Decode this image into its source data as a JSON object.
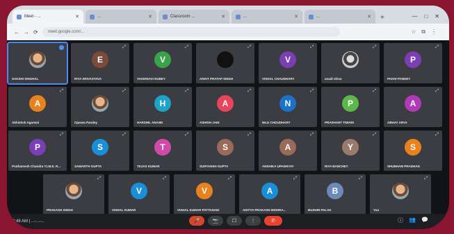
{
  "browser": {
    "tabs": [
      {
        "label": "Meet - ..."
      },
      {
        "label": "..."
      },
      {
        "label": "Classroom ..."
      },
      {
        "label": "..."
      },
      {
        "label": "..."
      }
    ],
    "new_tab": "+",
    "window_controls": [
      "—",
      "□",
      "✕"
    ],
    "url": "meet.google.com/..."
  },
  "participants_rows": [
    [
      {
        "name": "SAKSHI SINGHAL",
        "initial": "",
        "color": "",
        "kind": "photo",
        "active": true,
        "badge": "..."
      },
      {
        "name": "RIYA SRIVASTAVA",
        "initial": "E",
        "color": "#7a4a3a",
        "kind": "letter"
      },
      {
        "name": "VAISHNAVI DUBEY",
        "initial": "V",
        "color": "#3aa24a",
        "kind": "letter"
      },
      {
        "name": "ANKIT PRATAP SINGH",
        "initial": "",
        "color": "#111111",
        "kind": "dark"
      },
      {
        "name": "VISHAL CHAUDHARY",
        "initial": "V",
        "color": "#7b3fb5",
        "kind": "letter"
      },
      {
        "name": "anadi shiva",
        "initial": "",
        "color": "",
        "kind": "sketch"
      },
      {
        "name": "PAKHI PANDEY",
        "initial": "P",
        "color": "#7b3fb5",
        "kind": "letter"
      }
    ],
    [
      {
        "name": "Abhishek Agarwal",
        "initial": "A",
        "color": "#e8821e",
        "kind": "letter"
      },
      {
        "name": "Ojaswa Pandey",
        "initial": "",
        "color": "",
        "kind": "photo"
      },
      {
        "name": "HARSHIL ANAND",
        "initial": "H",
        "color": "#1ea3c8",
        "kind": "letter"
      },
      {
        "name": "ASHISH JAIN",
        "initial": "A",
        "color": "#e8455a",
        "kind": "letter"
      },
      {
        "name": "NILE CHOUDHARY",
        "initial": "N",
        "color": "#1a73c8",
        "kind": "letter"
      },
      {
        "name": "PRASHANT TIWARI",
        "initial": "P",
        "color": "#5cb84a",
        "kind": "letter"
      },
      {
        "name": "ABHAY ARYA",
        "initial": "A",
        "color": "#b03ab8",
        "kind": "letter"
      }
    ],
    [
      {
        "name": "Prathamesh Chandra T.I.M.E. R...",
        "initial": "P",
        "color": "#7b3fb5",
        "kind": "letter"
      },
      {
        "name": "SAMARTH GUPTA",
        "initial": "S",
        "color": "#1a8fd8",
        "kind": "letter"
      },
      {
        "name": "TEJAS KUMAR",
        "initial": "T",
        "color": "#d04aa8",
        "kind": "letter"
      },
      {
        "name": "SURYANSH GUPTA",
        "initial": "S",
        "color": "#9a6a5a",
        "kind": "letter"
      },
      {
        "name": "ANSHIKA UPADHYAY",
        "initial": "A",
        "color": "#9a6a5a",
        "kind": "letter"
      },
      {
        "name": "RIYA BANCHEY",
        "initial": "Y",
        "color": "#9a7a6a",
        "kind": "letter"
      },
      {
        "name": "SHUBHAM PRADHAN",
        "initial": "S",
        "color": "#e8821e",
        "kind": "letter"
      }
    ],
    [
      {
        "name": "PRAKASH SINGH",
        "initial": "",
        "color": "",
        "kind": "photo"
      },
      {
        "name": "VISHAL KUMAR",
        "initial": "V",
        "color": "#1a8fd8",
        "kind": "letter"
      },
      {
        "name": "VISHAL KUMAR PATTANAIK",
        "initial": "V",
        "color": "#e8821e",
        "kind": "letter"
      },
      {
        "name": "ADITYA PRAKASH MISHRA...",
        "initial": "A",
        "color": "#1a8fd8",
        "kind": "letter"
      },
      {
        "name": "BUSHRI PALAK",
        "initial": "B",
        "color": "#6a8ab8",
        "kind": "letter"
      },
      {
        "name": "You",
        "initial": "",
        "color": "",
        "kind": "photo"
      }
    ]
  ],
  "meeting_bar": {
    "info": "0:48 AM | ...-...-...",
    "controls": [
      "🎤",
      "📷",
      "☐",
      "⋮",
      "✆"
    ],
    "right_icons": [
      "ⓘ",
      "👥",
      "💬"
    ]
  }
}
